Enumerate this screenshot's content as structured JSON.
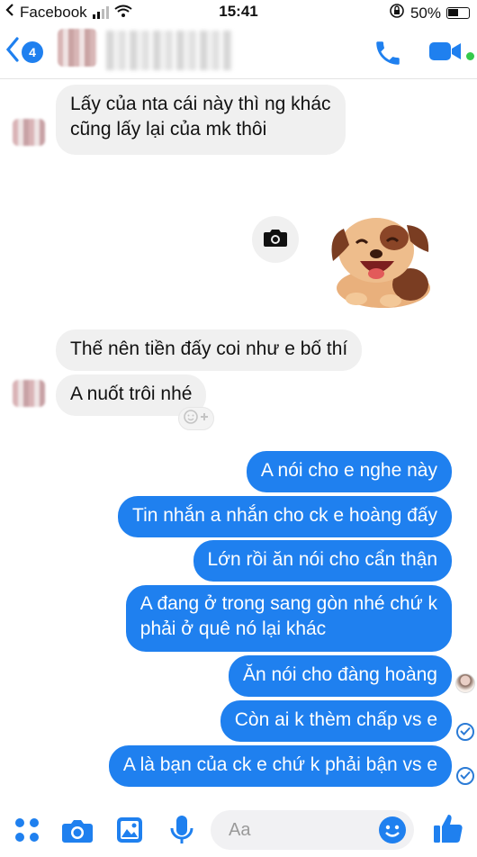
{
  "status_bar": {
    "app_name": "Facebook",
    "time": "15:41",
    "battery": "50%"
  },
  "header": {
    "back_count": "4"
  },
  "messages": {
    "incoming": [
      "Lấy của nta cái này thì ng khác",
      "cũng lấy lại của mk thôi",
      "Thế nên tiền đấy coi như e bố thí",
      "A nuốt trôi nhé"
    ],
    "outgoing": [
      "A nói cho e nghe này",
      "Tin nhắn a nhắn cho ck e hoàng đấy",
      "Lớn rồi ăn nói cho cẩn thận",
      "A đang ở trong sang gòn nhé chứ k",
      "phải ở quê nó lại khác",
      "Ăn nói cho đàng hoàng",
      "Còn ai k thèm chấp vs e",
      "A là bạn của ck e chứ k phải bận vs e"
    ]
  },
  "composer": {
    "placeholder": "Aa"
  },
  "colors": {
    "accent": "#1f80ef",
    "incoming_bubble": "#f0f0f0",
    "online": "#35c94b"
  },
  "icons": [
    "back-chevron-icon",
    "phone-icon",
    "video-camera-icon",
    "camera-icon",
    "dog-sticker",
    "add-reaction-icon",
    "check-circle-icon",
    "more-apps-icon",
    "photo-icon",
    "microphone-icon",
    "emoji-icon",
    "thumbs-up-icon"
  ]
}
